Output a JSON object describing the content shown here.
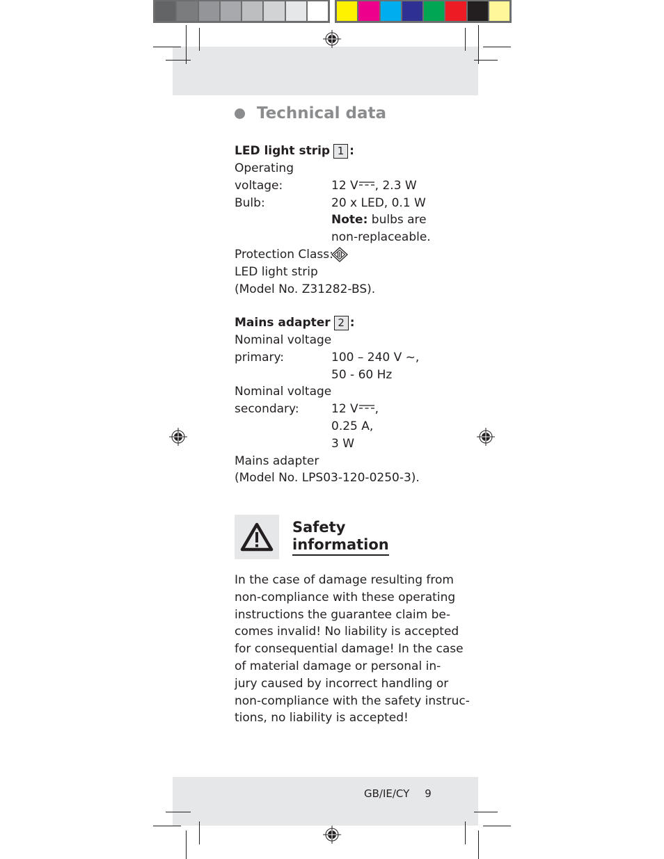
{
  "color_bars": {
    "grayscale": [
      "#636466",
      "#7b7c7e",
      "#939598",
      "#a7a9ac",
      "#bcbec0",
      "#d1d3d4",
      "#e6e7e8",
      "#ffffff"
    ],
    "process": [
      "#fff200",
      "#ec008c",
      "#00aeef",
      "#2e3192",
      "#00a651",
      "#ed1c24",
      "#231f20",
      "#fff799"
    ]
  },
  "technical_data": {
    "title": "Technical data",
    "led_strip": {
      "heading": "LED light strip",
      "number": "1",
      "colon": ":",
      "operating_label_1": "Operating",
      "operating_label_2": "voltage:",
      "operating_value_pre": "12 V",
      "operating_value_post": ", 2.3 W",
      "bulb_label": "Bulb:",
      "bulb_value": "20 x LED, 0.1 W",
      "note_label": "Note:",
      "note_text": " bulbs are",
      "note_text_2": "non-replaceable.",
      "protection_label": "Protection Class:",
      "protection_icon": "protection-class-iii-icon",
      "model_line_1": "LED light strip",
      "model_line_2": "(Model No. Z31282-BS)."
    },
    "mains_adapter": {
      "heading": "Mains adapter",
      "number": "2",
      "colon": ":",
      "primary_label_1": "Nominal voltage",
      "primary_label_2": "primary:",
      "primary_value_1": "100 – 240 V ~,",
      "primary_value_2": "50 - 60 Hz",
      "secondary_label_1": "Nominal voltage",
      "secondary_label_2": "secondary:",
      "secondary_value_pre": "12 V",
      "secondary_value_post": ",",
      "secondary_value_2": "0.25 A,",
      "secondary_value_3": "3 W",
      "model_line_1": "Mains adapter",
      "model_line_2": "(Model No. LPS03-120-0250-3)."
    }
  },
  "safety": {
    "icon": "warning-triangle-icon",
    "title_1": "Safety",
    "title_2": "information",
    "paragraph_lines": [
      "In the case of damage resulting from",
      "non-compliance with these operating",
      "instructions the guarantee claim be-",
      "comes invalid! No liability is accepted",
      "for consequential damage! In the case",
      "of material damage or personal in-",
      "jury caused by incorrect handling or",
      "non-compliance with the safety instruc-",
      "tions, no liability is accepted!"
    ]
  },
  "footer": {
    "region": "GB/IE/CY",
    "page_number": "9"
  }
}
